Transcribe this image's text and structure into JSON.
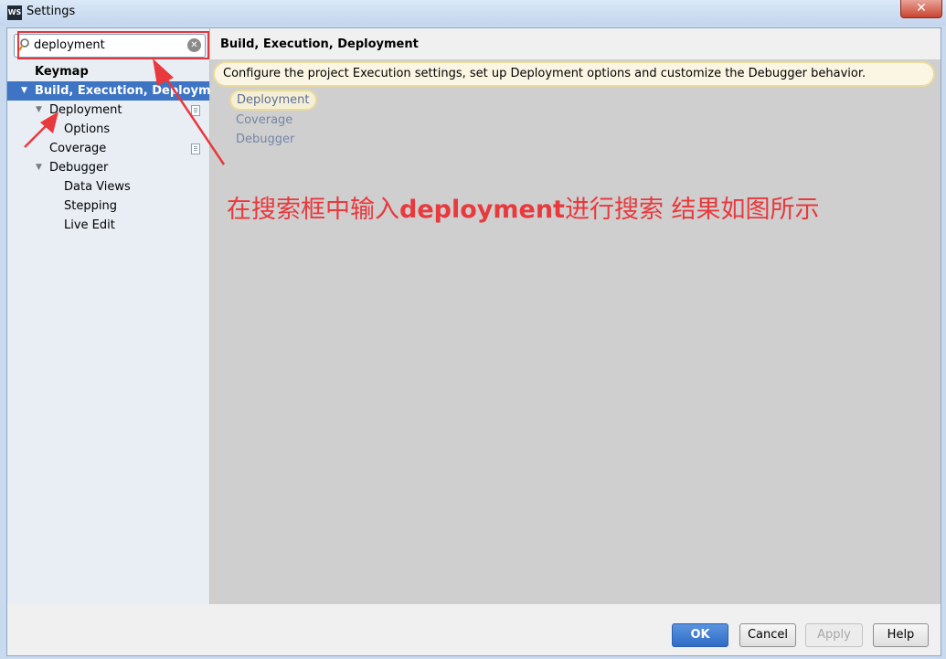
{
  "window": {
    "title": "Settings",
    "app_icon": "WS",
    "close_glyph": "✕"
  },
  "search": {
    "value": "deployment",
    "clear_glyph": "✕"
  },
  "sidebar": {
    "items": [
      {
        "label": "Keymap"
      },
      {
        "label": "Build, Execution, Deployment",
        "toggle": "▼"
      },
      {
        "label": "Deployment",
        "toggle": "▼"
      },
      {
        "label": "Options"
      },
      {
        "label": "Coverage"
      },
      {
        "label": "Debugger",
        "toggle": "▼"
      },
      {
        "label": "Data Views"
      },
      {
        "label": "Stepping"
      },
      {
        "label": "Live Edit"
      }
    ]
  },
  "content": {
    "title": "Build, Execution, Deployment",
    "description": "Configure the project Execution settings, set up Deployment options and customize the Debugger behavior.",
    "links": [
      "Deployment",
      "Coverage",
      "Debugger"
    ]
  },
  "annotation": {
    "text_before": "在搜索框中输入",
    "text_keyword": "deployment",
    "text_after": "进行搜索 结果如图所示",
    "color": "#e8393d"
  },
  "buttons": {
    "ok": "OK",
    "cancel": "Cancel",
    "apply": "Apply",
    "help": "Help"
  },
  "colors": {
    "selection": "#3d74c4",
    "highlight_border": "#eadb9b",
    "annotation_red": "#e8393d"
  }
}
